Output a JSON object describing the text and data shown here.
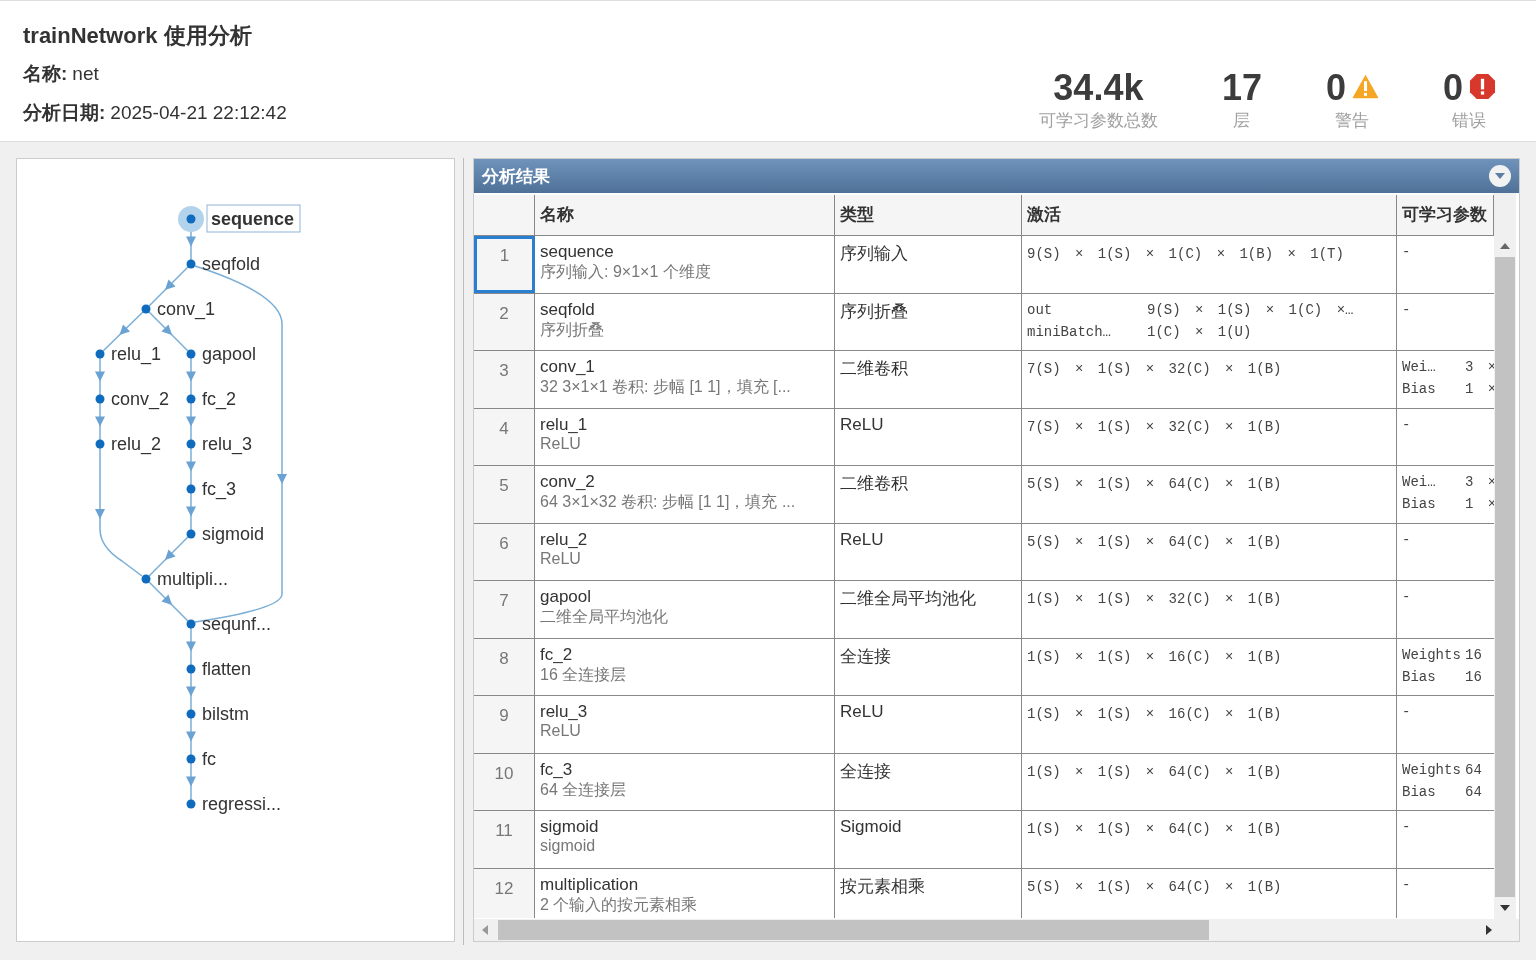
{
  "header": {
    "title": "trainNetwork 使用分析",
    "info": [
      {
        "label": "名称:",
        "value": "net"
      },
      {
        "label": "分析日期:",
        "value": "2025-04-21 22:12:42"
      }
    ],
    "stats": [
      {
        "kind": "plain",
        "value": "34.4k",
        "label": "可学习参数总数"
      },
      {
        "kind": "plain",
        "value": "17",
        "label": "层"
      },
      {
        "kind": "warning",
        "value": "0",
        "label": "警告"
      },
      {
        "kind": "error",
        "value": "0",
        "label": "错误"
      }
    ]
  },
  "graph": {
    "nodes": [
      {
        "label": "sequence",
        "selected": true
      },
      {
        "label": "seqfold",
        "selected": false
      },
      {
        "label": "conv_1",
        "selected": false
      },
      {
        "label": "relu_1",
        "selected": false
      },
      {
        "label": "gapool",
        "selected": false
      },
      {
        "label": "conv_2",
        "selected": false
      },
      {
        "label": "fc_2",
        "selected": false
      },
      {
        "label": "relu_2",
        "selected": false
      },
      {
        "label": "relu_3",
        "selected": false
      },
      {
        "label": "fc_3",
        "selected": false
      },
      {
        "label": "sigmoid",
        "selected": false
      },
      {
        "label": "multipli...",
        "selected": false
      },
      {
        "label": "sequnf...",
        "selected": false
      },
      {
        "label": "flatten",
        "selected": false
      },
      {
        "label": "bilstm",
        "selected": false
      },
      {
        "label": "fc",
        "selected": false
      },
      {
        "label": "regressi...",
        "selected": false
      }
    ]
  },
  "results": {
    "title": "分析结果",
    "columns": [
      "名称",
      "类型",
      "激活",
      "可学习参数"
    ],
    "rows": [
      {
        "index": "1",
        "selected": true,
        "name": "sequence",
        "description": "序列输入: 9×1×1 个维度",
        "type": "序列输入",
        "activations": [
          {
            "value": "9(S) × 1(S) × 1(C) × 1(B) × 1(T)"
          }
        ],
        "params": [
          {
            "name": "-"
          }
        ]
      },
      {
        "index": "2",
        "selected": false,
        "name": "seqfold",
        "description": "序列折叠",
        "type": "序列折叠",
        "activations": [
          {
            "label": "out",
            "value": "9(S) × 1(S) × 1(C) ×…"
          },
          {
            "label": "miniBatch…",
            "value": "1(C) × 1(U)"
          }
        ],
        "params": [
          {
            "name": "-"
          }
        ]
      },
      {
        "index": "3",
        "selected": false,
        "name": "conv_1",
        "description": "32 3×1×1 卷积: 步幅 [1 1]，填充 [...",
        "type": "二维卷积",
        "activations": [
          {
            "value": "7(S) × 1(S) × 32(C) × 1(B)"
          }
        ],
        "params": [
          {
            "name": "Wei…",
            "value": "3 ×"
          },
          {
            "name": "Bias",
            "value": "1 ×"
          }
        ]
      },
      {
        "index": "4",
        "selected": false,
        "name": "relu_1",
        "description": "ReLU",
        "type": "ReLU",
        "activations": [
          {
            "value": "7(S) × 1(S) × 32(C) × 1(B)"
          }
        ],
        "params": [
          {
            "name": "-"
          }
        ]
      },
      {
        "index": "5",
        "selected": false,
        "name": "conv_2",
        "description": "64 3×1×32 卷积: 步幅 [1 1]，填充 ...",
        "type": "二维卷积",
        "activations": [
          {
            "value": "5(S) × 1(S) × 64(C) × 1(B)"
          }
        ],
        "params": [
          {
            "name": "Wei…",
            "value": "3 ×"
          },
          {
            "name": "Bias",
            "value": "1 ×"
          }
        ]
      },
      {
        "index": "6",
        "selected": false,
        "name": "relu_2",
        "description": "ReLU",
        "type": "ReLU",
        "activations": [
          {
            "value": "5(S) × 1(S) × 64(C) × 1(B)"
          }
        ],
        "params": [
          {
            "name": "-"
          }
        ]
      },
      {
        "index": "7",
        "selected": false,
        "name": "gapool",
        "description": "二维全局平均池化",
        "type": "二维全局平均池化",
        "activations": [
          {
            "value": "1(S) × 1(S) × 32(C) × 1(B)"
          }
        ],
        "params": [
          {
            "name": "-"
          }
        ]
      },
      {
        "index": "8",
        "selected": false,
        "name": "fc_2",
        "description": "16 全连接层",
        "type": "全连接",
        "activations": [
          {
            "value": "1(S) × 1(S) × 16(C) × 1(B)"
          }
        ],
        "params": [
          {
            "name": "Weights",
            "value": "16"
          },
          {
            "name": "Bias",
            "value": "16"
          }
        ]
      },
      {
        "index": "9",
        "selected": false,
        "name": "relu_3",
        "description": "ReLU",
        "type": "ReLU",
        "activations": [
          {
            "value": "1(S) × 1(S) × 16(C) × 1(B)"
          }
        ],
        "params": [
          {
            "name": "-"
          }
        ]
      },
      {
        "index": "10",
        "selected": false,
        "name": "fc_3",
        "description": "64 全连接层",
        "type": "全连接",
        "activations": [
          {
            "value": "1(S) × 1(S) × 64(C) × 1(B)"
          }
        ],
        "params": [
          {
            "name": "Weights",
            "value": "64"
          },
          {
            "name": "Bias",
            "value": "64"
          }
        ]
      },
      {
        "index": "11",
        "selected": false,
        "name": "sigmoid",
        "description": "sigmoid",
        "type": "Sigmoid",
        "activations": [
          {
            "value": "1(S) × 1(S) × 64(C) × 1(B)"
          }
        ],
        "params": [
          {
            "name": "-"
          }
        ]
      },
      {
        "index": "12",
        "selected": false,
        "name": "multiplication",
        "description": "2 个输入的按元素相乘",
        "type": "按元素相乘",
        "activations": [
          {
            "value": "5(S) × 1(S) × 64(C) × 1(B)"
          }
        ],
        "params": [
          {
            "name": "-"
          }
        ]
      }
    ]
  }
}
